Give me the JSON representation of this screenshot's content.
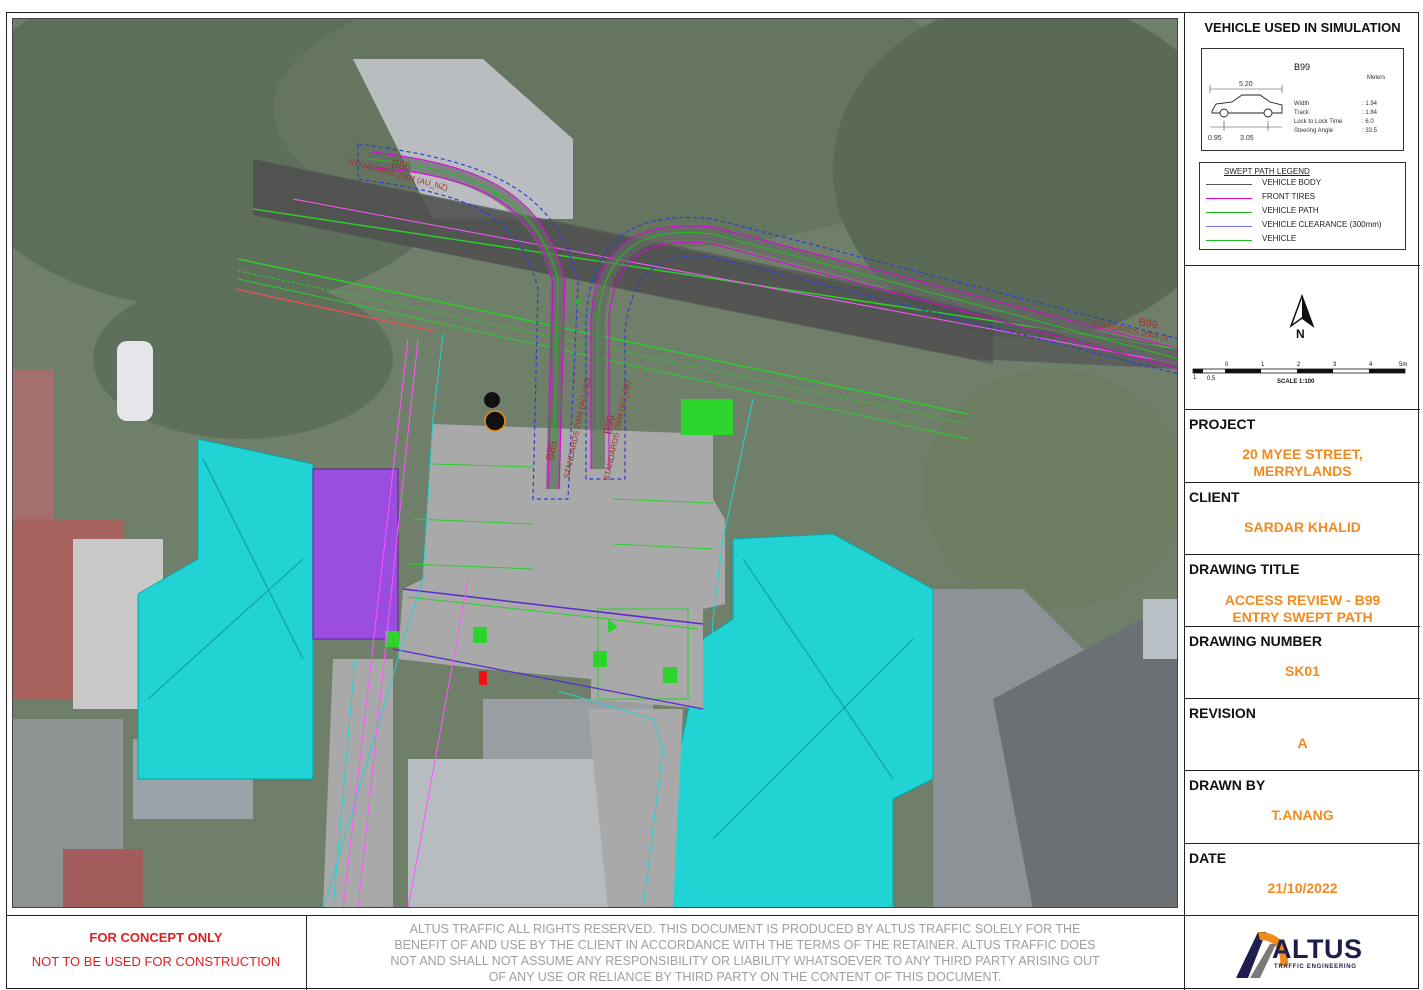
{
  "vehicle": {
    "section_title": "VEHICLE USED IN SIMULATION",
    "name": "B99",
    "units": "Meters",
    "length_dim": "5.20",
    "front_overhang": "0.95",
    "wheelbase": "3.05",
    "specs": [
      {
        "label": "Width",
        "value": ":  1.94"
      },
      {
        "label": "Track",
        "value": ":  1.84"
      },
      {
        "label": "Lock to Lock Time",
        "value": ":  6.0"
      },
      {
        "label": "Steering Angle",
        "value": ":  33.5"
      }
    ]
  },
  "legend": {
    "title": "SWEPT PATH LEGEND",
    "items": [
      {
        "label": "VEHICLE BODY",
        "color": "#555555"
      },
      {
        "label": "FRONT TIRES",
        "color": "#e000e0"
      },
      {
        "label": "VEHICLE PATH",
        "color": "#22bb22"
      },
      {
        "label": "VEHICLE CLEARANCE (300mm)",
        "color": "#7070ff"
      },
      {
        "label": "VEHICLE",
        "color": "#22bb22"
      }
    ]
  },
  "north": {
    "letter": "N"
  },
  "scale": {
    "ticks": [
      "1",
      "0.5",
      "0",
      "1",
      "2",
      "3",
      "4",
      "5m"
    ],
    "label": "SCALE  1:100"
  },
  "titleblock": {
    "project_label": "PROJECT",
    "project_line1": "20 MYEE STREET,",
    "project_line2": "MERRYLANDS",
    "client_label": "CLIENT",
    "client": "SARDAR KHALID",
    "drawing_title_label": "DRAWING TITLE",
    "drawing_title_line1": "ACCESS REVIEW - B99",
    "drawing_title_line2": "ENTRY SWEPT PATH",
    "drawing_number_label": "DRAWING NUMBER",
    "drawing_number": "SK01",
    "revision_label": "REVISION",
    "revision": "A",
    "drawn_by_label": "DRAWN BY",
    "drawn_by": "T.ANANG",
    "date_label": "DATE",
    "date": "21/10/2022"
  },
  "map_labels": {
    "b85_top": "B85",
    "b85_top_std": "STANDARDS 2004 (AU_NZ)",
    "b99_right": "B99",
    "b99_right_std": "STANDARDS 2004 (A",
    "b85_mid": "B85",
    "b85_mid_std": "STANDARDS 2004 (AU_NZ)",
    "b99_mid": "B99",
    "b99_mid_std": "STANDARDS 2004 (AU_NZ)"
  },
  "footer": {
    "concept_line1": "FOR CONCEPT ONLY",
    "concept_line2": "NOT TO BE USED FOR CONSTRUCTION",
    "disclaimer": [
      "ALTUS TRAFFIC ALL RIGHTS RESERVED. THIS DOCUMENT IS PRODUCED BY ALTUS TRAFFIC SOLELY FOR THE",
      "BENEFIT OF AND USE BY THE CLIENT IN ACCORDANCE WITH THE TERMS OF THE RETAINER. ALTUS TRAFFIC DOES",
      "NOT AND SHALL NOT ASSUME ANY RESPONSIBILITY OR LIABILITY WHATSOEVER TO ANY THIRD PARTY ARISING OUT",
      "OF ANY USE OR RELIANCE BY THIRD PARTY ON THE CONTENT OF THIS DOCUMENT."
    ],
    "logo_text": "ALTUS",
    "logo_sub": "TRAFFIC ENGINEERING"
  },
  "colors": {
    "accent": "#f38a1d",
    "warning": "#e02020",
    "roof": "#22d3d3",
    "purple": "#9b4de0",
    "paving": "#a9a9a9",
    "path": "#22bb22",
    "tires": "#e000e0",
    "clearance": "#2a3fd6"
  }
}
